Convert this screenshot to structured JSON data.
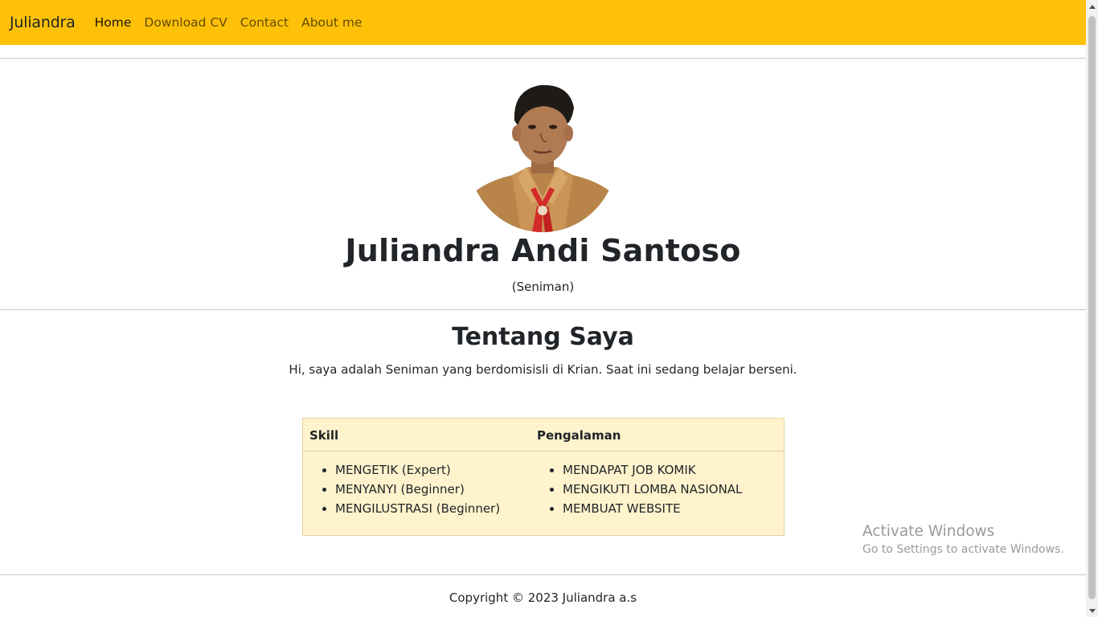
{
  "navbar": {
    "brand": "Juliandra",
    "links": [
      "Home",
      "Download CV",
      "Contact",
      "About me"
    ],
    "color": "#ffc107"
  },
  "hero": {
    "name": "Juliandra Andi Santoso",
    "role": "(Seniman)"
  },
  "about": {
    "title": "Tentang Saya",
    "text": "Hi, saya adalah Seniman yang berdomisisli di Krian. Saat ini sedang belajar berseni."
  },
  "table": {
    "headers": [
      "Skill",
      "Pengalaman"
    ],
    "skills": [
      "MENGETIK (Expert)",
      "MENYANYI (Beginner)",
      "MENGILUSTRASI (Beginner)"
    ],
    "experience": [
      "MENDAPAT JOB KOMIK",
      "MENGIKUTI LOMBA NASIONAL",
      "MEMBUAT WEBSITE"
    ],
    "background": "#fff3cd"
  },
  "watermark": {
    "line1": "Activate Windows",
    "line2": "Go to Settings to activate Windows."
  },
  "footer": {
    "text": "Copyright © 2023 Juliandra a.s"
  }
}
